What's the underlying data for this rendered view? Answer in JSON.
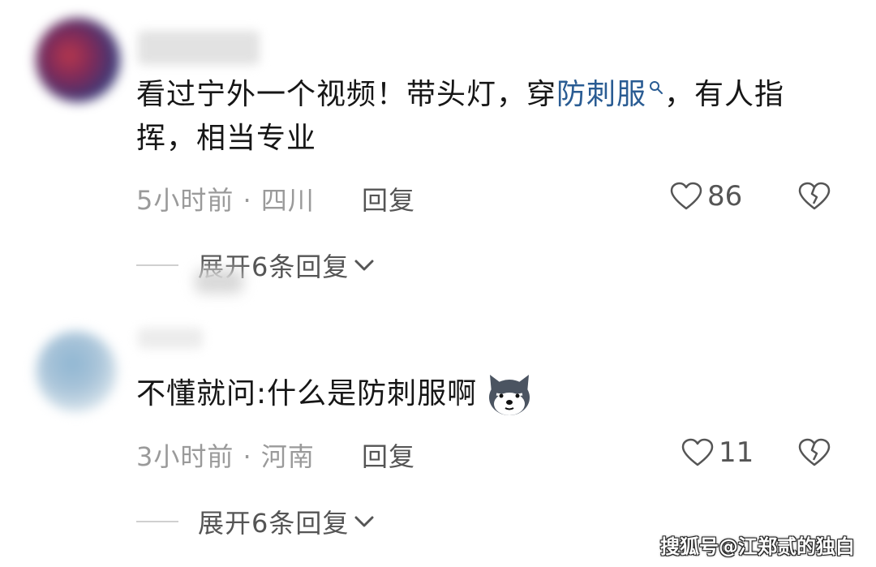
{
  "comments": [
    {
      "text_before": "看过宁外一个视频！带头灯，穿",
      "link_text": "防刺服",
      "text_after": "，有人指挥，相当专业",
      "time": "5小时前",
      "sep": "·",
      "location": "四川",
      "reply_label": "回复",
      "like_count": "86",
      "expand_label": "展开6条回复"
    },
    {
      "text": "不懂就问:什么是防刺服啊",
      "emoji": "dog-face-emoji",
      "time": "3小时前",
      "sep": "·",
      "location": "河南",
      "reply_label": "回复",
      "like_count": "11",
      "expand_label": "展开6条回复"
    }
  ],
  "watermark": "搜狐号@江郑贰的独白",
  "colors": {
    "link": "#2a5c93",
    "meta": "#9a9a9a",
    "text": "#161616"
  },
  "icons": [
    "search-icon",
    "heart-icon",
    "broken-heart-icon",
    "chevron-down-icon"
  ]
}
